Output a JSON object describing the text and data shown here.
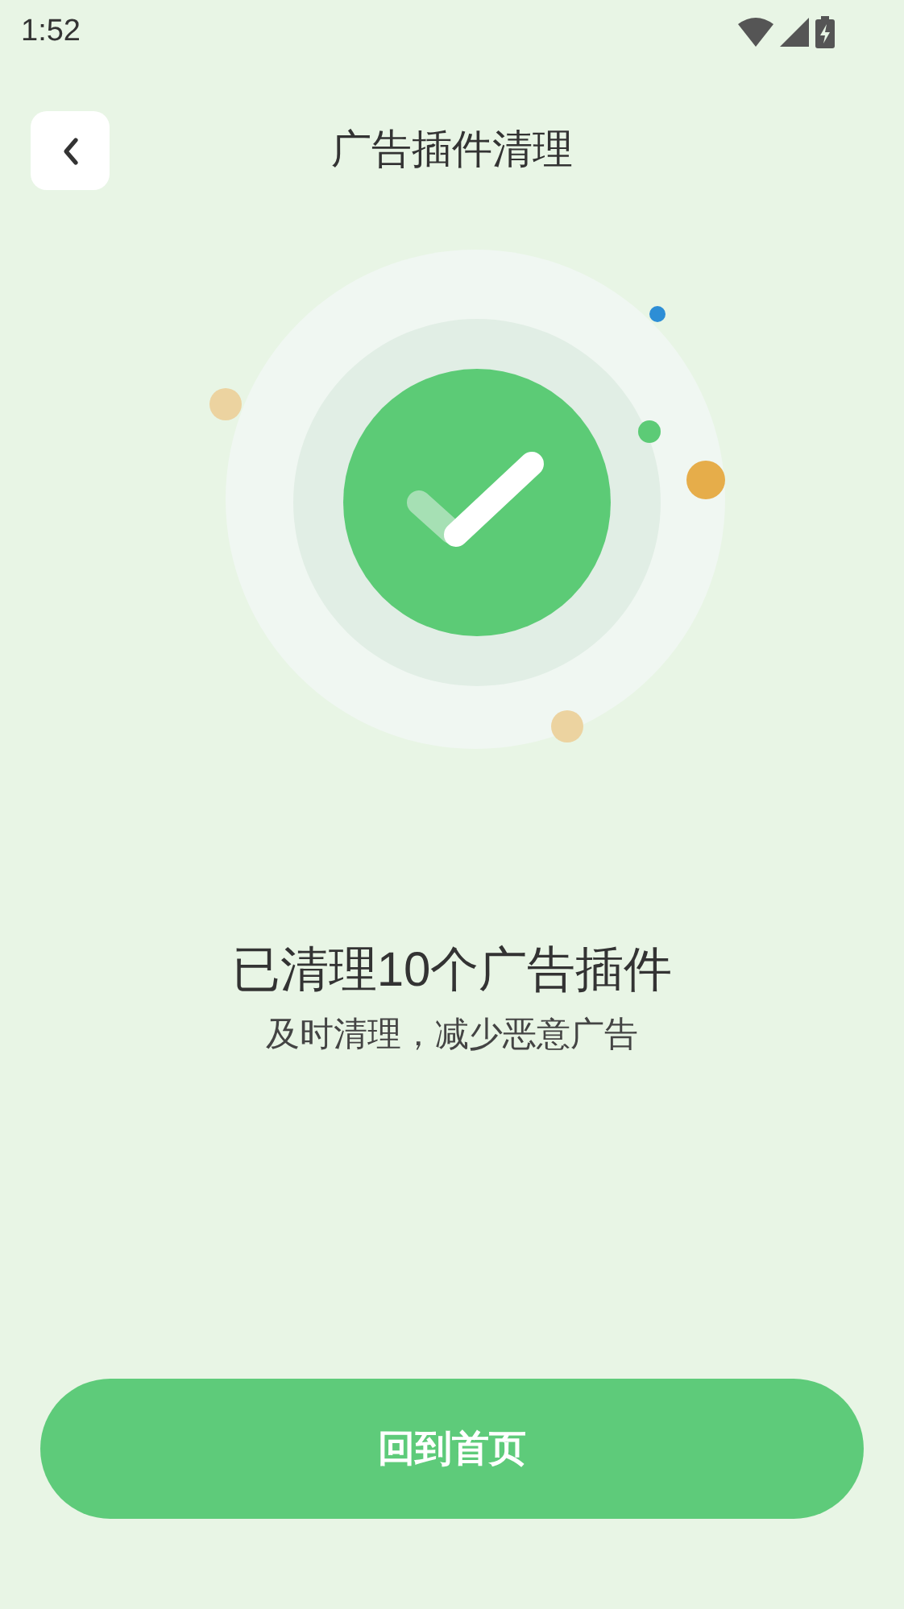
{
  "status_bar": {
    "time": "1:52"
  },
  "header": {
    "title": "广告插件清理"
  },
  "result": {
    "title": "已清理10个广告插件",
    "subtitle": "及时清理，减少恶意广告"
  },
  "buttons": [
    "回到首页"
  ]
}
